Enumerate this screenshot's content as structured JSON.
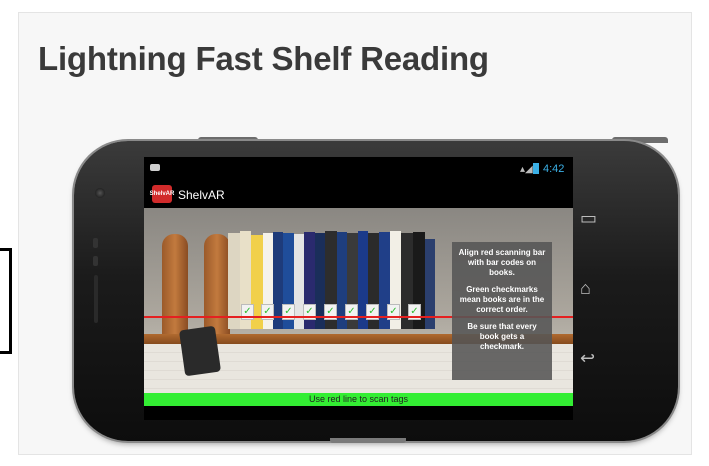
{
  "slide": {
    "heading": "Lightning Fast Shelf Reading"
  },
  "status_bar": {
    "time": "4:42",
    "signal_icon": "signal-icon",
    "battery_icon": "battery-icon"
  },
  "app": {
    "name": "ShelvAR",
    "icon_text": "ShelvAR"
  },
  "overlay": {
    "line1": "Align red scanning bar with bar codes on books.",
    "line2": "Green checkmarks mean books are in the correct order.",
    "line3": "Be sure that every book gets a checkmark."
  },
  "scan_bar": {
    "label": "Use red line to scan tags"
  },
  "nav_icons": {
    "recent": "recent-apps-icon",
    "home": "home-icon",
    "back": "back-icon"
  },
  "colors": {
    "accent_green": "#33ee33",
    "scan_red": "#e52020",
    "status_blue": "#3bb0e6"
  }
}
